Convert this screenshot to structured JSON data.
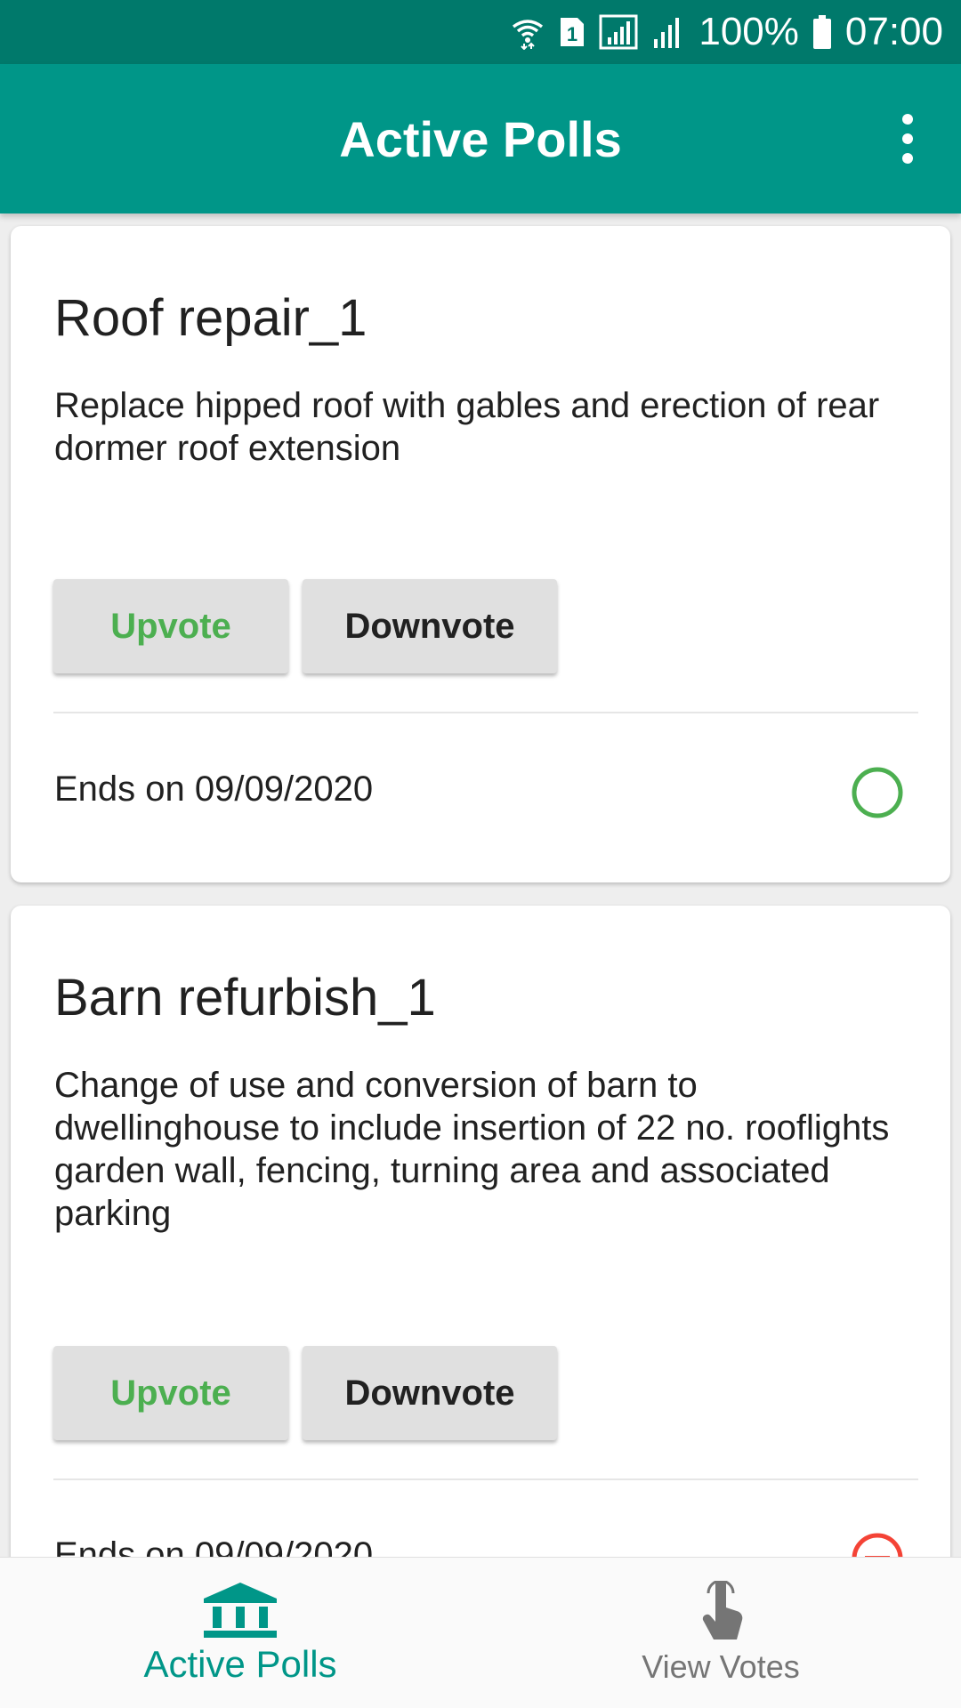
{
  "status_bar": {
    "battery": "100%",
    "time": "07:00",
    "sim_slot": "1"
  },
  "app_bar": {
    "title": "Active Polls",
    "menu_icon": "more-vert-icon"
  },
  "polls": [
    {
      "title": "Roof repair_1",
      "description": "Replace hipped roof with gables and erection of rear dormer roof extension",
      "upvote_label": "Upvote",
      "downvote_label": "Downvote",
      "ends": "Ends on 09/09/2020",
      "status_icon": "open-circle-icon",
      "status_color": "#4caf50"
    },
    {
      "title": "Barn refurbish_1",
      "description": "Change of use and conversion of barn to dwellinghouse to include insertion of 22 no. rooflights garden wall, fencing, turning area and associated parking",
      "upvote_label": "Upvote",
      "downvote_label": "Downvote",
      "ends": "Ends on 09/09/2020",
      "status_icon": "minus-circle-icon",
      "status_color": "#f44336"
    }
  ],
  "bottom_nav": {
    "items": [
      {
        "label": "Active Polls",
        "icon": "bank-icon",
        "active": true
      },
      {
        "label": "View Votes",
        "icon": "touch-icon",
        "active": false
      }
    ]
  },
  "colors": {
    "primary": "#009688",
    "primary_dark": "#00796b",
    "upvote": "#4caf50",
    "closed": "#f44336"
  }
}
